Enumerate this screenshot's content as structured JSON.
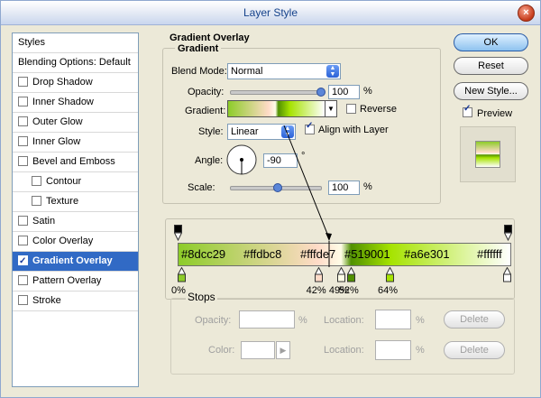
{
  "window": {
    "title": "Layer Style",
    "close_glyph": "×"
  },
  "styles_list": {
    "header": "Styles",
    "blending_options": "Blending Options: Default",
    "items": [
      {
        "label": "Drop Shadow",
        "checked": false,
        "indent": false,
        "selected": false
      },
      {
        "label": "Inner Shadow",
        "checked": false,
        "indent": false,
        "selected": false
      },
      {
        "label": "Outer Glow",
        "checked": false,
        "indent": false,
        "selected": false
      },
      {
        "label": "Inner Glow",
        "checked": false,
        "indent": false,
        "selected": false
      },
      {
        "label": "Bevel and Emboss",
        "checked": false,
        "indent": false,
        "selected": false
      },
      {
        "label": "Contour",
        "checked": false,
        "indent": true,
        "selected": false
      },
      {
        "label": "Texture",
        "checked": false,
        "indent": true,
        "selected": false
      },
      {
        "label": "Satin",
        "checked": false,
        "indent": false,
        "selected": false
      },
      {
        "label": "Color Overlay",
        "checked": false,
        "indent": false,
        "selected": false
      },
      {
        "label": "Gradient Overlay",
        "checked": true,
        "indent": false,
        "selected": true
      },
      {
        "label": "Pattern Overlay",
        "checked": false,
        "indent": false,
        "selected": false
      },
      {
        "label": "Stroke",
        "checked": false,
        "indent": false,
        "selected": false
      }
    ]
  },
  "gradient_overlay": {
    "section_title": "Gradient Overlay",
    "group_title": "Gradient",
    "blend_mode_label": "Blend Mode:",
    "blend_mode_value": "Normal",
    "opacity_label": "Opacity:",
    "opacity_value": "100",
    "opacity_unit": "%",
    "opacity_level": 1.0,
    "gradient_label": "Gradient:",
    "reverse_label": "Reverse",
    "reverse_checked": false,
    "style_label": "Style:",
    "style_value": "Linear",
    "align_label": "Align with Layer",
    "align_checked": true,
    "angle_label": "Angle:",
    "angle_value": "-90",
    "angle_unit": "°",
    "scale_label": "Scale:",
    "scale_value": "100",
    "scale_unit": "%",
    "scale_level": 0.5
  },
  "buttons": {
    "ok": "OK",
    "reset": "Reset",
    "new_style": "New Style...",
    "preview_label": "Preview",
    "preview_checked": true
  },
  "gradient_editor": {
    "stops": [
      {
        "color": "#8dcc29",
        "label": "#8dcc29",
        "location": 0,
        "pct_label": "0%"
      },
      {
        "color": "#ffdbc8",
        "label": "#ffdbc8",
        "location": 42,
        "pct_label": "42%"
      },
      {
        "color": "#fffde7",
        "label": "#fffde7",
        "location": 49,
        "pct_label": "49%"
      },
      {
        "color": "#519001",
        "label": "#519001",
        "location": 52,
        "pct_label": "52%"
      },
      {
        "color": "#a6e301",
        "label": "#a6e301",
        "location": 64,
        "pct_label": "64%"
      },
      {
        "color": "#ffffff",
        "label": "#ffffff",
        "location": 100,
        "pct_label": ""
      }
    ],
    "stops_group_title": "Stops",
    "opacity_label": "Opacity:",
    "opacity_unit": "%",
    "location_label": "Location:",
    "location_unit": "%",
    "delete_label": "Delete",
    "color_label": "Color:"
  }
}
